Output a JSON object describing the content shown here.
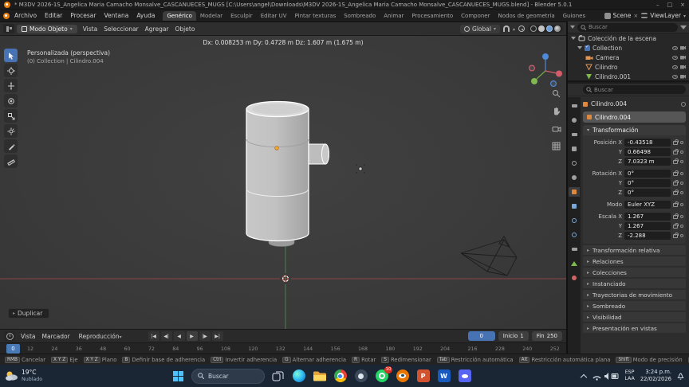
{
  "window": {
    "title": "* M3DV 2026-1S_Angelica Maria Camacho Monsalve_CASCANUECES_MUGS [C:\\Users\\angel\\Downloads\\M3DV 2026-1S_Angelica Maria Camacho Monsalve_CASCANUECES_MUGS.blend] - Blender 5.0.1",
    "controls": {
      "minimize": "–",
      "maximize": "□",
      "close": "×"
    }
  },
  "colors": {
    "accent": "#4772b3",
    "selection_outline": "#ffffff",
    "object_origin": "#ffab40",
    "axis_x": "#8f4444",
    "axis_y": "#4e7e4e"
  },
  "menubar": {
    "menus": [
      "Archivo",
      "Editar",
      "Procesar",
      "Ventana",
      "Ayuda"
    ],
    "workspaces": [
      "Genérico",
      "Modelar",
      "Esculpir",
      "Editar UV",
      "Pintar texturas",
      "Sombreado",
      "Animar",
      "Procesamiento",
      "Componer",
      "Nodos de geometría",
      "Guiones"
    ],
    "active_workspace": "Genérico",
    "scene_label": "Scene",
    "viewlayer_label": "ViewLayer"
  },
  "tool_header": {
    "mode": "Modo Objeto",
    "menus": [
      "Vista",
      "Seleccionar",
      "Agregar",
      "Objeto"
    ],
    "orientation": "Global"
  },
  "viewport": {
    "transform_info": "Dx: 0.008253 m  Dy: 0.4728 m  Dz: 1.607 m (1.675 m)",
    "view_name": "Personalizada (perspectiva)",
    "context_path": "(0) Collection | Cilindro.004",
    "operator": "Duplicar"
  },
  "outliner": {
    "search_placeholder": "Buscar",
    "root": "Colección de la escena",
    "items": [
      {
        "label": "Collection"
      },
      {
        "label": "Camera"
      },
      {
        "label": "Cilindro"
      },
      {
        "label": "Cilindro.001"
      }
    ]
  },
  "properties": {
    "search_placeholder": "Buscar",
    "breadcrumb": "Cilindro.004",
    "object_name": "Cilindro.004",
    "transform_title": "Transformación",
    "rows": [
      {
        "label": "Posición X",
        "value": "-0.43518"
      },
      {
        "label": "Y",
        "value": "0.66498"
      },
      {
        "label": "Z",
        "value": "7.0323 m"
      },
      {
        "label": "Rotación X",
        "value": "0°"
      },
      {
        "label": "Y",
        "value": "0°"
      },
      {
        "label": "Z",
        "value": "0°"
      },
      {
        "label": "Modo",
        "value": "Euler XYZ"
      },
      {
        "label": "Escala X",
        "value": "1.267"
      },
      {
        "label": "Y",
        "value": "1.267"
      },
      {
        "label": "Z",
        "value": "-2.288"
      }
    ],
    "sections": [
      "Transformación relativa",
      "Relaciones",
      "Colecciones",
      "Instanciado",
      "Trayectorias de movimiento",
      "Sombreado",
      "Visibilidad",
      "Presentación en vistas"
    ]
  },
  "timeline": {
    "menus": [
      "Vista",
      "Marcador"
    ],
    "playback_label": "Reproducción",
    "current_frame": "0",
    "start_label": "Inicio",
    "start_value": "1",
    "end_label": "Fin",
    "end_value": "250",
    "ticks": [
      "12",
      "24",
      "36",
      "48",
      "60",
      "72",
      "84",
      "96",
      "108",
      "120",
      "132",
      "144",
      "156",
      "168",
      "180",
      "192",
      "204",
      "216",
      "228",
      "240",
      "252"
    ]
  },
  "statusbar": {
    "hints": [
      {
        "keys": "RMB",
        "label": "Cancelar"
      },
      {
        "keys": "X Y Z",
        "label": "Eje"
      },
      {
        "keys": "X Y Z",
        "label": "Plano"
      },
      {
        "keys": "B",
        "label": "Definir base de adherencia"
      },
      {
        "keys": "Ctrl",
        "label": "Invertir adherencia"
      },
      {
        "keys": "G",
        "label": "Alternar adherencia"
      },
      {
        "keys": "R",
        "label": "Rotar"
      },
      {
        "keys": "S",
        "label": "Redimensionar"
      },
      {
        "keys": "Tab",
        "label": "Restricción automática"
      },
      {
        "keys": "Alt",
        "label": "Restricción automática plana"
      },
      {
        "keys": "Shift",
        "label": "Modo de precisión"
      },
      {
        "keys": "Alt",
        "label": "Navi..."
      }
    ]
  },
  "taskbar": {
    "weather_temp": "19°C",
    "weather_desc": "Nublado",
    "search_placeholder": "Buscar",
    "badge_count": "10",
    "app_letters": {
      "powerpoint": "P",
      "word": "W"
    },
    "apps": [
      "task-view",
      "edge",
      "file-explorer",
      "chrome",
      "steam",
      "whatsapp",
      "blender",
      "powerpoint",
      "word",
      "discord"
    ],
    "tray_lang_line1": "ESP",
    "tray_lang_line2": "LAA",
    "time": "3:24 p.m.",
    "date": "22/02/2026"
  }
}
